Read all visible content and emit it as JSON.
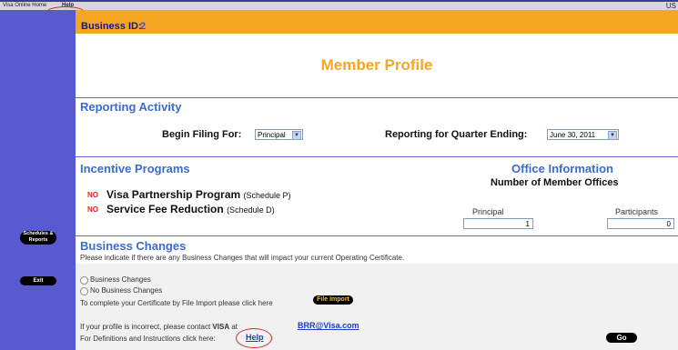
{
  "topnav": {
    "home_label": "Visa Online Home",
    "help_label": "Help",
    "right_text": "US"
  },
  "sidebar": {
    "schedules_reports_label": "Schedules & Reports",
    "exit_label": "Exit"
  },
  "business": {
    "id_label": "Business ID:",
    "id_value": "2"
  },
  "page_title": "Member Profile",
  "reporting": {
    "heading": "Reporting Activity",
    "filing_label": "Begin Filing For:",
    "filing_value": "Principal",
    "quarter_label": "Reporting for Quarter Ending:",
    "quarter_value": "June 30, 2011"
  },
  "incentive": {
    "heading": "Incentive Programs",
    "programs": [
      {
        "status": "NO",
        "name": "Visa Partnership Program",
        "schedule": "(Schedule P)"
      },
      {
        "status": "NO",
        "name": "Service Fee Reduction",
        "schedule": "(Schedule D)"
      }
    ]
  },
  "office": {
    "heading": "Office Information",
    "subheading": "Number of Member Offices",
    "principal_label": "Principal",
    "principal_value": "1",
    "participants_label": "Participants",
    "participants_value": "0"
  },
  "business_changes": {
    "heading": "Business Changes",
    "description": "Please indicate if there are any Business Changes that will impact your current Operating Certificate.",
    "option_changes": "Business Changes",
    "option_no_changes": "No Business Changes",
    "file_import_text": "To complete your Certificate by File Import please click here",
    "file_import_button": "File Import",
    "contact_text_before": "If your profile is incorrect, please contact",
    "contact_bold": "VISA",
    "contact_at": "at",
    "contact_email": "BRR@Visa.com",
    "definitions_text": "For Definitions and Instructions click here:",
    "help_link": "Help",
    "go_button": "Go"
  },
  "colors": {
    "sidebar": "#5a5ad0",
    "orange": "#f5a623",
    "heading_blue": "#3a6bd0",
    "no_red": "#e02020",
    "annotation_red": "#d42a2a"
  }
}
